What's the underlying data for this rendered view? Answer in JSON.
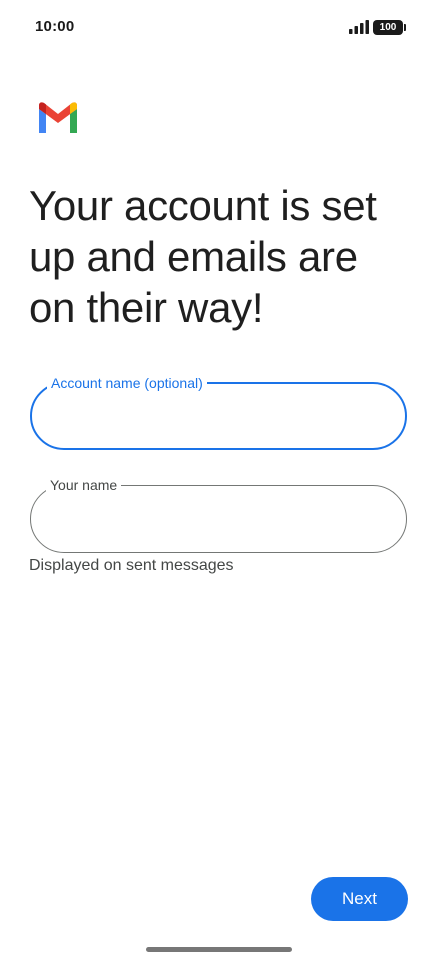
{
  "status_bar": {
    "time": "10:00",
    "signal_icon": "signal-bars-icon",
    "battery_level": "100"
  },
  "logo": {
    "icon": "gmail-logo-icon",
    "colors": {
      "red": "#EA4335",
      "blue": "#4285F4",
      "green": "#34A853",
      "yellow": "#FBBC04",
      "dark_red": "#C5221F"
    }
  },
  "headline": "Your account is set up and emails are on their way!",
  "fields": {
    "account_name": {
      "label": "Account name (optional)",
      "value": "",
      "focused": true
    },
    "your_name": {
      "label": "Your name",
      "value": "",
      "helper": "Displayed on sent messages"
    }
  },
  "actions": {
    "next_label": "Next"
  },
  "colors": {
    "accent": "#1a73e8",
    "text_primary": "#1f1f1f",
    "text_secondary": "#444746",
    "outline": "#747775"
  }
}
